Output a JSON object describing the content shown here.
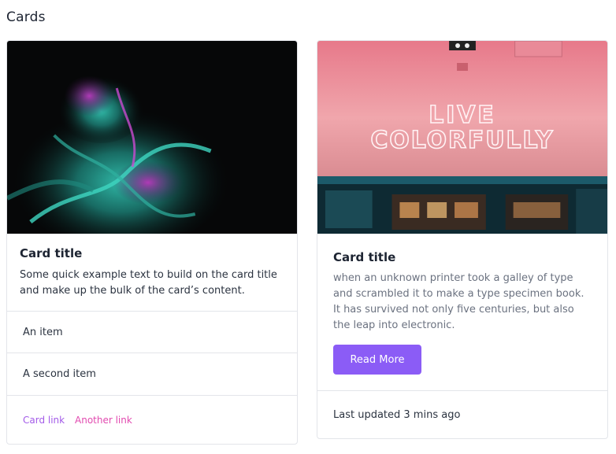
{
  "page": {
    "title": "Cards"
  },
  "card_1": {
    "image": "abstract-fluid-art-image",
    "title": "Card title",
    "text": "Some quick example text to build on the card title and make up the bulk of the card’s content.",
    "list_items": [
      "An item",
      "A second item"
    ],
    "links": [
      "Card link",
      "Another link"
    ]
  },
  "card_2": {
    "image": "neon-sign-image",
    "image_sign_text": [
      "LIVE",
      "COLORFULLY"
    ],
    "title": "Card title",
    "text": "when an unknown printer took a galley of type and scrambled it to make a type specimen book. It has survived not only five centuries, but also the leap into electronic.",
    "button_label": "Read More",
    "footer": "Last updated 3 mins ago"
  },
  "colors": {
    "accent": "#8b5cf6",
    "link_primary": "#a35be8",
    "link_secondary": "#e24bb0",
    "border": "#e3e5ea"
  }
}
